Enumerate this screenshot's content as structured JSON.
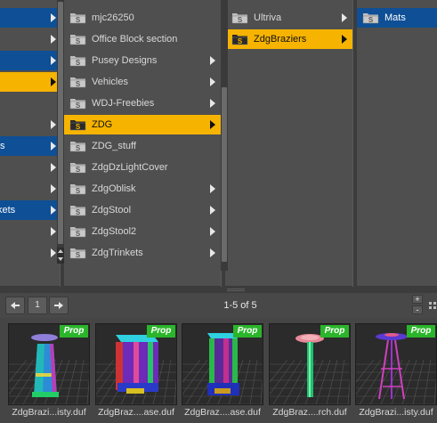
{
  "col1": {
    "items": [
      {
        "label": "",
        "state": "blue",
        "arrow": true
      },
      {
        "label": "",
        "state": "none",
        "arrow": true
      },
      {
        "label": "",
        "state": "blue",
        "arrow": true
      },
      {
        "label": "",
        "state": "orange",
        "arrow": true
      },
      {
        "label": "",
        "state": "none",
        "arrow": false
      },
      {
        "label": "",
        "state": "none",
        "arrow": true
      },
      {
        "label": "ts",
        "state": "blue",
        "arrow": true
      },
      {
        "label": "",
        "state": "none",
        "arrow": true
      },
      {
        "label": "",
        "state": "none",
        "arrow": true
      },
      {
        "label": "kets",
        "state": "blue",
        "arrow": true
      },
      {
        "label": "",
        "state": "none",
        "arrow": true
      },
      {
        "label": "",
        "state": "none",
        "arrow": true
      }
    ]
  },
  "col2": {
    "items": [
      {
        "label": "mjc26250",
        "state": "none",
        "arrow": false
      },
      {
        "label": "Office Block section",
        "state": "none",
        "arrow": false
      },
      {
        "label": "Pusey Designs",
        "state": "none",
        "arrow": true
      },
      {
        "label": "Vehicles",
        "state": "none",
        "arrow": true
      },
      {
        "label": "WDJ-Freebies",
        "state": "none",
        "arrow": true
      },
      {
        "label": "ZDG",
        "state": "orange",
        "arrow": true
      },
      {
        "label": "ZDG_stuff",
        "state": "none",
        "arrow": false
      },
      {
        "label": "ZdgDzLightCover",
        "state": "none",
        "arrow": false
      },
      {
        "label": "ZdgOblisk",
        "state": "none",
        "arrow": true
      },
      {
        "label": "ZdgStool",
        "state": "none",
        "arrow": true
      },
      {
        "label": "ZdgStool2",
        "state": "none",
        "arrow": true
      },
      {
        "label": "ZdgTrinkets",
        "state": "none",
        "arrow": true
      }
    ]
  },
  "col3": {
    "items": [
      {
        "label": "Ultriva",
        "state": "none",
        "arrow": true
      },
      {
        "label": "ZdgBraziers",
        "state": "orange",
        "arrow": true
      }
    ]
  },
  "col4": {
    "items": [
      {
        "label": "Mats",
        "state": "blue",
        "arrow": false
      }
    ]
  },
  "nav": {
    "page": "1",
    "counter": "1-5 of 5",
    "zoom_in": "+",
    "zoom_out": "-"
  },
  "thumbnails": [
    {
      "name": "ZdgBrazi...isty.duf",
      "badge": "Prop",
      "style": "obelisk"
    },
    {
      "name": "ZdgBraz....ase.duf",
      "badge": "Prop",
      "style": "cube-tall"
    },
    {
      "name": "ZdgBraz....ase.duf",
      "badge": "Prop",
      "style": "cube-short"
    },
    {
      "name": "ZdgBraz....rch.duf",
      "badge": "Prop",
      "style": "torch"
    },
    {
      "name": "ZdgBrazi...isty.duf",
      "badge": "Prop",
      "style": "tripod"
    }
  ],
  "colors": {
    "selection_blue": "#0e4f96",
    "selection_orange": "#f6b400",
    "prop_badge": "#2bb52b",
    "panel_bg": "#4f4f4f"
  }
}
